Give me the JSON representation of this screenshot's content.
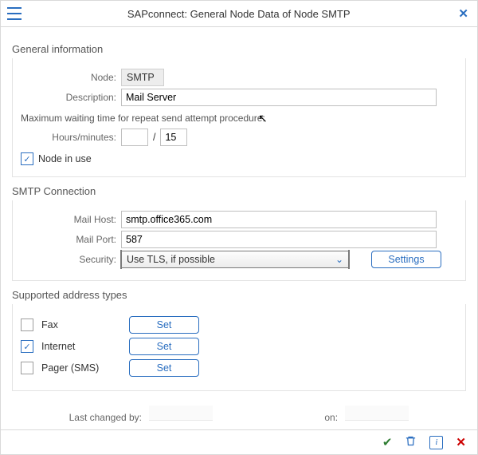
{
  "titlebar": {
    "title": "SAPconnect: General Node Data of Node SMTP"
  },
  "section_general": {
    "title": "General information",
    "node_label": "Node:",
    "node_value": "SMTP",
    "description_label": "Description:",
    "description_value": "Mail Server",
    "wait_note": "Maximum waiting time for repeat send attempt procedure:",
    "hours_label": "Hours/minutes:",
    "hours_value": "",
    "minutes_value": "15",
    "node_in_use_label": "Node in use",
    "node_in_use_checked": true
  },
  "section_smtp": {
    "title": "SMTP Connection",
    "mail_host_label": "Mail Host:",
    "mail_host_value": "smtp.office365.com",
    "mail_port_label": "Mail Port:",
    "mail_port_value": "587",
    "security_label": "Security:",
    "security_value": "Use TLS, if possible",
    "settings_label": "Settings"
  },
  "section_addr": {
    "title": "Supported address types",
    "set_label": "Set",
    "items": [
      {
        "label": "Fax",
        "checked": false
      },
      {
        "label": "Internet",
        "checked": true
      },
      {
        "label": "Pager (SMS)",
        "checked": false
      }
    ]
  },
  "footer_meta": {
    "changed_by_label": "Last changed by:",
    "changed_by_value": "",
    "on_label": "on:",
    "on_value": ""
  }
}
